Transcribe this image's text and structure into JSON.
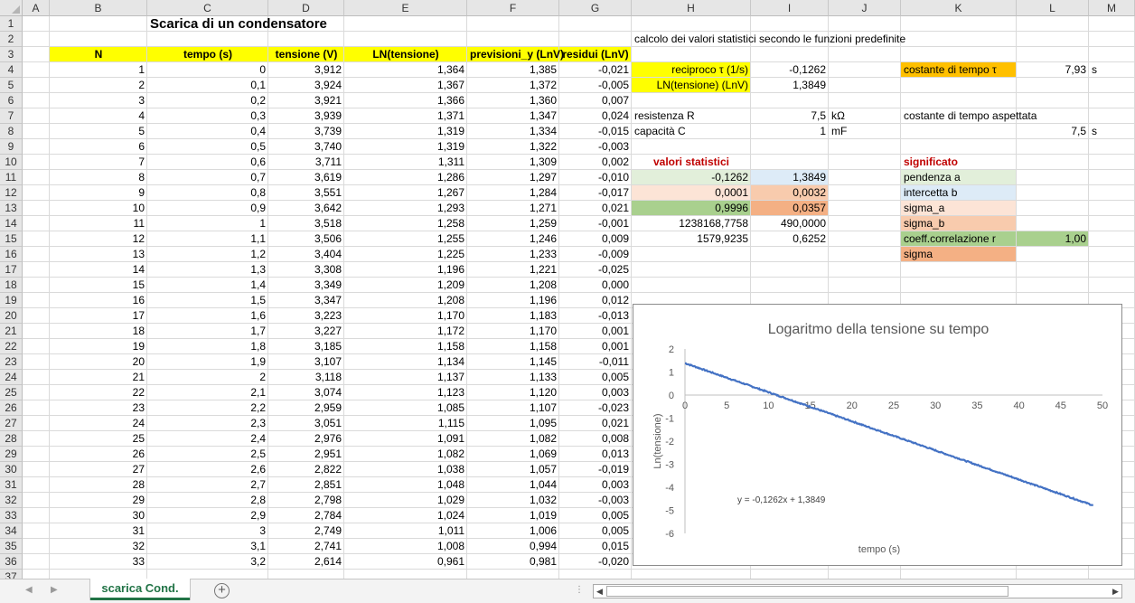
{
  "columns": [
    "A",
    "B",
    "C",
    "D",
    "E",
    "F",
    "G",
    "H",
    "I",
    "J",
    "K",
    "L",
    "M"
  ],
  "title": "Scarica di un condensatore",
  "headers": {
    "n": "N",
    "tempo": "tempo (s)",
    "tensione": "tensione (V)",
    "ln": "LN(tensione)",
    "previsioni": "previsioni_y (LnV)",
    "residui": "residui (LnV)"
  },
  "table": [
    [
      "1",
      "0",
      "3,912",
      "1,364",
      "1,385",
      "-0,021"
    ],
    [
      "2",
      "0,1",
      "3,924",
      "1,367",
      "1,372",
      "-0,005"
    ],
    [
      "3",
      "0,2",
      "3,921",
      "1,366",
      "1,360",
      "0,007"
    ],
    [
      "4",
      "0,3",
      "3,939",
      "1,371",
      "1,347",
      "0,024"
    ],
    [
      "5",
      "0,4",
      "3,739",
      "1,319",
      "1,334",
      "-0,015"
    ],
    [
      "6",
      "0,5",
      "3,740",
      "1,319",
      "1,322",
      "-0,003"
    ],
    [
      "7",
      "0,6",
      "3,711",
      "1,311",
      "1,309",
      "0,002"
    ],
    [
      "8",
      "0,7",
      "3,619",
      "1,286",
      "1,297",
      "-0,010"
    ],
    [
      "9",
      "0,8",
      "3,551",
      "1,267",
      "1,284",
      "-0,017"
    ],
    [
      "10",
      "0,9",
      "3,642",
      "1,293",
      "1,271",
      "0,021"
    ],
    [
      "11",
      "1",
      "3,518",
      "1,258",
      "1,259",
      "-0,001"
    ],
    [
      "12",
      "1,1",
      "3,506",
      "1,255",
      "1,246",
      "0,009"
    ],
    [
      "13",
      "1,2",
      "3,404",
      "1,225",
      "1,233",
      "-0,009"
    ],
    [
      "14",
      "1,3",
      "3,308",
      "1,196",
      "1,221",
      "-0,025"
    ],
    [
      "15",
      "1,4",
      "3,349",
      "1,209",
      "1,208",
      "0,000"
    ],
    [
      "16",
      "1,5",
      "3,347",
      "1,208",
      "1,196",
      "0,012"
    ],
    [
      "17",
      "1,6",
      "3,223",
      "1,170",
      "1,183",
      "-0,013"
    ],
    [
      "18",
      "1,7",
      "3,227",
      "1,172",
      "1,170",
      "0,001"
    ],
    [
      "19",
      "1,8",
      "3,185",
      "1,158",
      "1,158",
      "0,001"
    ],
    [
      "20",
      "1,9",
      "3,107",
      "1,134",
      "1,145",
      "-0,011"
    ],
    [
      "21",
      "2",
      "3,118",
      "1,137",
      "1,133",
      "0,005"
    ],
    [
      "22",
      "2,1",
      "3,074",
      "1,123",
      "1,120",
      "0,003"
    ],
    [
      "23",
      "2,2",
      "2,959",
      "1,085",
      "1,107",
      "-0,023"
    ],
    [
      "24",
      "2,3",
      "3,051",
      "1,115",
      "1,095",
      "0,021"
    ],
    [
      "25",
      "2,4",
      "2,976",
      "1,091",
      "1,082",
      "0,008"
    ],
    [
      "26",
      "2,5",
      "2,951",
      "1,082",
      "1,069",
      "0,013"
    ],
    [
      "27",
      "2,6",
      "2,822",
      "1,038",
      "1,057",
      "-0,019"
    ],
    [
      "28",
      "2,7",
      "2,851",
      "1,048",
      "1,044",
      "0,003"
    ],
    [
      "29",
      "2,8",
      "2,798",
      "1,029",
      "1,032",
      "-0,003"
    ],
    [
      "30",
      "2,9",
      "2,784",
      "1,024",
      "1,019",
      "0,005"
    ],
    [
      "31",
      "3",
      "2,749",
      "1,011",
      "1,006",
      "0,005"
    ],
    [
      "32",
      "3,1",
      "2,741",
      "1,008",
      "0,994",
      "0,015"
    ],
    [
      "33",
      "3,2",
      "2,614",
      "0,961",
      "0,981",
      "-0,020"
    ]
  ],
  "stats": {
    "heading": "calcolo dei valori statistici secondo le funzioni predefinite",
    "reciproco_label": "reciproco τ (1/s)",
    "reciproco_value": "-0,1262",
    "ln_label": "LN(tensione) (LnV)",
    "ln_value": "1,3849",
    "costante_label": "costante di tempo τ",
    "costante_value": "7,93",
    "costante_unit": "s",
    "resistenza_label": "resistenza R",
    "resistenza_value": "7,5",
    "resistenza_unit": "kΩ",
    "capacita_label": "capacità C",
    "capacita_value": "1",
    "capacita_unit": "mF",
    "aspettata_label": "costante di tempo aspettata",
    "aspettata_value": "7,5",
    "aspettata_unit": "s",
    "valori_heading": "valori statistici",
    "significato_heading": "significato",
    "linest": [
      [
        "-0,1262",
        "1,3849"
      ],
      [
        "0,0001",
        "0,0032"
      ],
      [
        "0,9996",
        "0,0357"
      ],
      [
        "1238168,7758",
        "490,0000"
      ],
      [
        "1579,9235",
        "0,6252"
      ]
    ],
    "meanings": [
      "pendenza a",
      "intercetta b",
      "sigma_a",
      "sigma_b",
      "coeff.correlazione r",
      "sigma"
    ],
    "r_value": "1,00"
  },
  "colors": {
    "yellow": "#ffff00",
    "orange": "#f4b084",
    "light_green": "#e2efda",
    "light_blue": "#ddebf7",
    "light_peach": "#fce4d6",
    "peach": "#f8cbad",
    "green": "#a9d08e",
    "gold": "#ffc000",
    "red_text": "#c00000",
    "line_blue": "#4472c4"
  },
  "chart_data": {
    "type": "scatter",
    "title": "Logaritmo della tensione su tempo",
    "xlabel": "tempo (s)",
    "ylabel": "Ln(tensione)",
    "xlim": [
      0,
      50
    ],
    "ylim": [
      -6,
      2
    ],
    "xticks": [
      0,
      5,
      10,
      15,
      20,
      25,
      30,
      35,
      40,
      45,
      50
    ],
    "yticks": [
      2,
      1,
      0,
      -1,
      -2,
      -3,
      -4,
      -5,
      -6
    ],
    "trendline_label": "y = -0,1262x + 1,3849",
    "slope": -0.1262,
    "intercept": 1.3849,
    "x_range": [
      0,
      48.9
    ],
    "series_color": "#4472c4",
    "grid": false
  },
  "sheet_tab": "scarica Cond."
}
